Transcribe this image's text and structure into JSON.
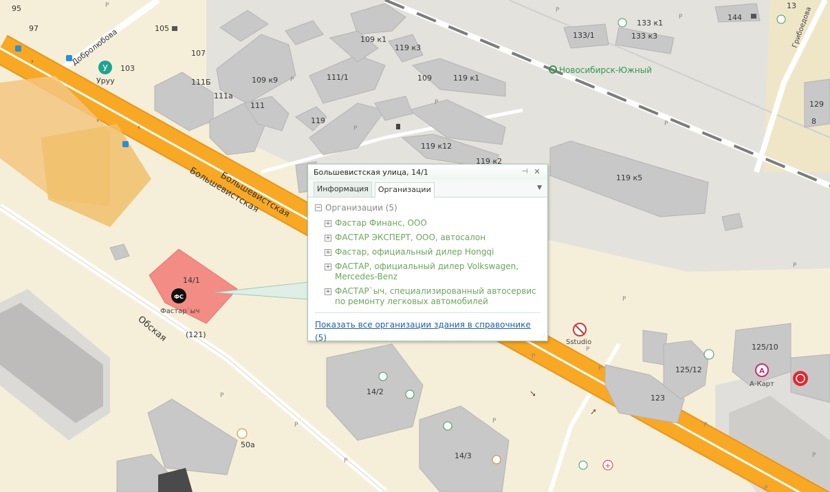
{
  "map": {
    "streets": {
      "bolshevistskaya": "Большевистская",
      "obskaya": "Обская",
      "dobrolyubova": "Добролюбова",
      "griboedova": "Грибоедова"
    },
    "station": "Новосибирск-Южный",
    "places": {
      "uruu": "Уруу",
      "uruu_badge": "У",
      "fastar_ych": "Фастар`ыч",
      "fastar_badge": "ФС",
      "sstudio": "Sstudio",
      "a_kart": "А-Карт",
      "a_kart_badge": "А"
    },
    "buildings": [
      "95",
      "97",
      "105",
      "107",
      "103",
      "111Б",
      "111а",
      "111",
      "109 к9",
      "109 к1",
      "119 к3",
      "111/1",
      "109",
      "119 к1",
      "119",
      "119 к12",
      "119 к2",
      "119 к5",
      "133/1",
      "133 к1",
      "133 к3",
      "144",
      "13",
      "129",
      "8",
      "14/1",
      "(121)",
      "14/2",
      "14/3",
      "50а",
      "125/10",
      "125/12",
      "123"
    ],
    "parking_label": "P"
  },
  "popup": {
    "title": "Большевистская улица, 14/1",
    "tabs": [
      "Информация",
      "Организации"
    ],
    "active_tab": "Организации",
    "group_label": "Организации",
    "group_count": "(5)",
    "organizations": [
      "Фастар Финанс, ООО",
      "ФАСТАР ЭКСПЕРТ, ООО, автосалон",
      "Фастар, официальный дилер Hongqi",
      "ФАСТАР, официальный дилер Volkswagen, Mercedes-Benz",
      "ФАСТАР`ыч, специализированный автосервис по ремонту легковых автомобилей"
    ],
    "footer_link": "Показать все организации здания в справочнике",
    "footer_count": "(5)"
  },
  "colors": {
    "background": "#f5efd9",
    "road_major": "#f5a623",
    "highlight_building": "#f2827b",
    "rail": "#777777",
    "link": "#1d5fa6",
    "org_text": "#6aa55a"
  }
}
